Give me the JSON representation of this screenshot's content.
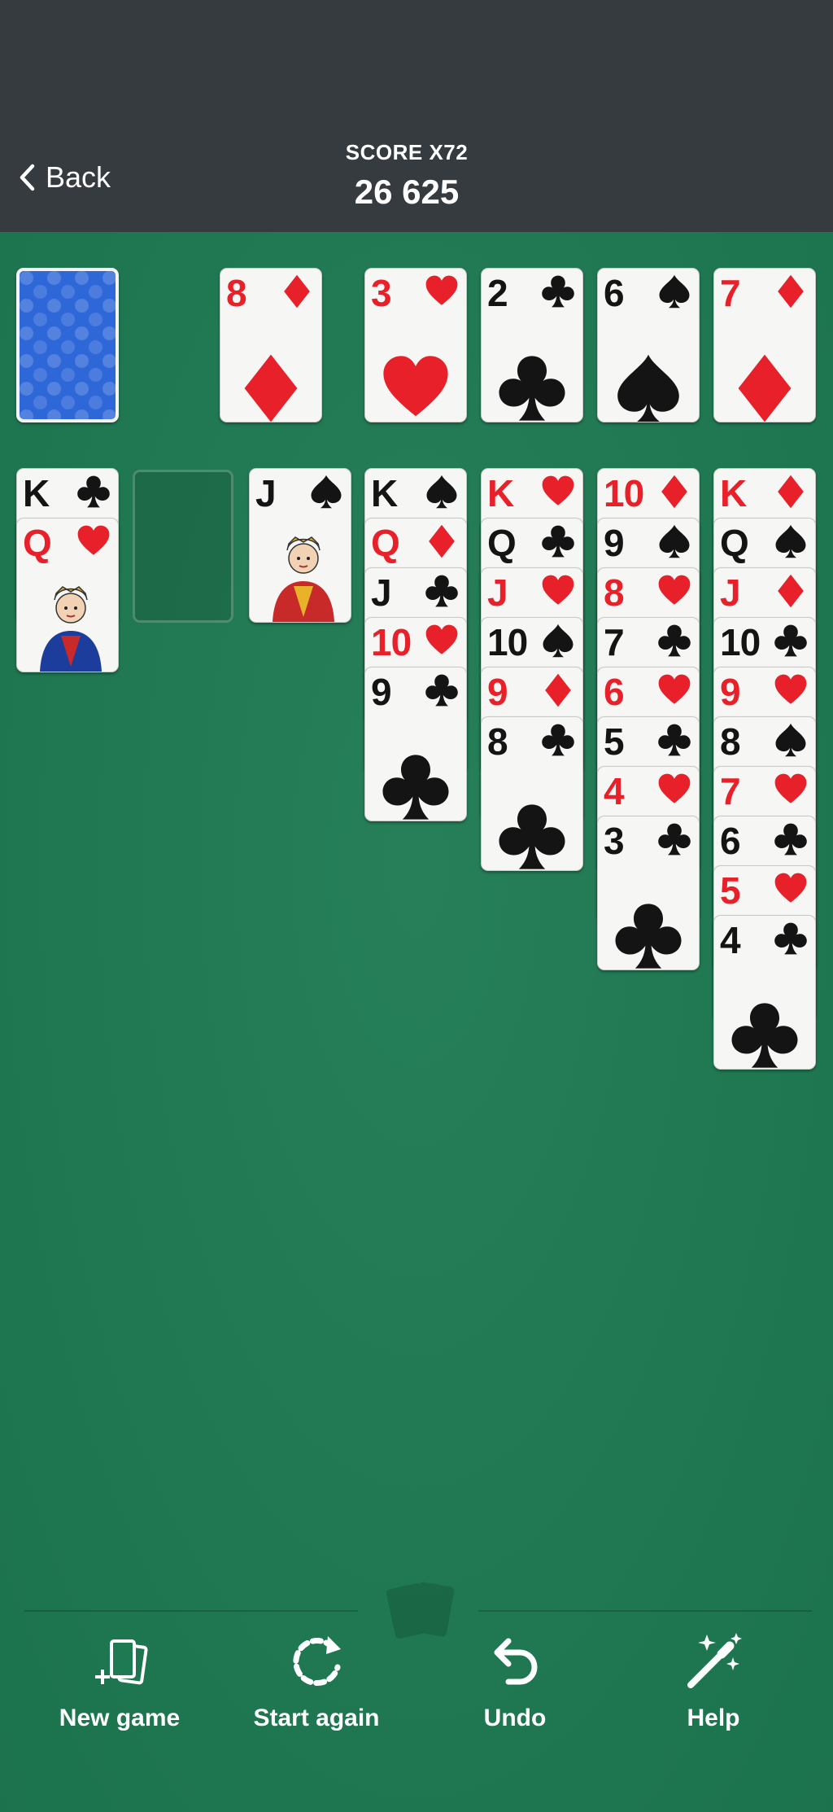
{
  "header": {
    "back_label": "Back",
    "score_label": "SCORE X72",
    "score_value": "26 625"
  },
  "colors": {
    "header_bg": "#363b40",
    "felt": "#1d7a52",
    "red_suit": "#e8202a",
    "black_suit": "#141414",
    "card_back": "#2e67d8"
  },
  "stock": {
    "face_down": true
  },
  "waste": {
    "rank": "8",
    "suit": "diamond"
  },
  "foundations": [
    {
      "rank": "3",
      "suit": "heart"
    },
    {
      "rank": "2",
      "suit": "club"
    },
    {
      "rank": "6",
      "suit": "spade"
    },
    {
      "rank": "7",
      "suit": "diamond"
    }
  ],
  "tableau": [
    {
      "cards": [
        {
          "rank": "K",
          "suit": "club"
        },
        {
          "rank": "Q",
          "suit": "heart"
        }
      ]
    },
    {
      "cards": []
    },
    {
      "cards": [
        {
          "rank": "J",
          "suit": "spade"
        }
      ]
    },
    {
      "cards": [
        {
          "rank": "K",
          "suit": "spade"
        },
        {
          "rank": "Q",
          "suit": "diamond"
        },
        {
          "rank": "J",
          "suit": "club"
        },
        {
          "rank": "10",
          "suit": "heart"
        },
        {
          "rank": "9",
          "suit": "club"
        }
      ]
    },
    {
      "cards": [
        {
          "rank": "K",
          "suit": "heart"
        },
        {
          "rank": "Q",
          "suit": "club"
        },
        {
          "rank": "J",
          "suit": "heart"
        },
        {
          "rank": "10",
          "suit": "spade"
        },
        {
          "rank": "9",
          "suit": "diamond"
        },
        {
          "rank": "8",
          "suit": "club"
        }
      ]
    },
    {
      "cards": [
        {
          "rank": "10",
          "suit": "diamond"
        },
        {
          "rank": "9",
          "suit": "spade"
        },
        {
          "rank": "8",
          "suit": "heart"
        },
        {
          "rank": "7",
          "suit": "club"
        },
        {
          "rank": "6",
          "suit": "heart"
        },
        {
          "rank": "5",
          "suit": "club"
        },
        {
          "rank": "4",
          "suit": "heart"
        },
        {
          "rank": "3",
          "suit": "club"
        }
      ]
    },
    {
      "cards": [
        {
          "rank": "K",
          "suit": "diamond"
        },
        {
          "rank": "Q",
          "suit": "spade"
        },
        {
          "rank": "J",
          "suit": "diamond"
        },
        {
          "rank": "10",
          "suit": "club"
        },
        {
          "rank": "9",
          "suit": "heart"
        },
        {
          "rank": "8",
          "suit": "spade"
        },
        {
          "rank": "7",
          "suit": "heart"
        },
        {
          "rank": "6",
          "suit": "club"
        },
        {
          "rank": "5",
          "suit": "heart"
        },
        {
          "rank": "4",
          "suit": "club"
        }
      ]
    }
  ],
  "toolbar": {
    "new_game": {
      "label": "New game",
      "icon": "new-game-cards-icon"
    },
    "start_again": {
      "label": "Start again",
      "icon": "restart-icon"
    },
    "undo": {
      "label": "Undo",
      "icon": "undo-icon"
    },
    "help": {
      "label": "Help",
      "icon": "magic-wand-icon"
    }
  }
}
